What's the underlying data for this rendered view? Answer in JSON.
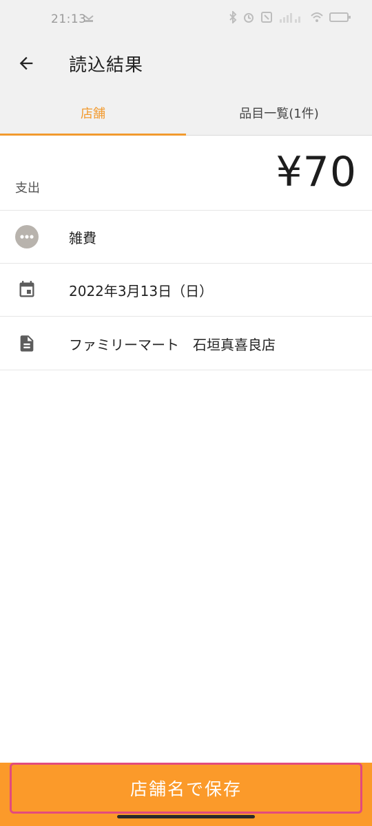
{
  "status_bar": {
    "time": "21:13"
  },
  "app_bar": {
    "title": "読込結果"
  },
  "tabs": [
    {
      "label": "店舗",
      "active": true
    },
    {
      "label": "品目一覧(1件)",
      "active": false
    }
  ],
  "amount": {
    "label": "支出",
    "value": "¥70"
  },
  "details": {
    "category": {
      "icon": "more-horiz-icon",
      "text": "雑費"
    },
    "date": {
      "icon": "calendar-icon",
      "text": "2022年3月13日（日）"
    },
    "store": {
      "icon": "document-icon",
      "text": "ファミリーマート　石垣真喜良店"
    }
  },
  "save_button": {
    "label": "店舗名で保存"
  },
  "colors": {
    "accent": "#f29a2e",
    "button": "#fb9a2a",
    "highlight_border": "#e24b7d"
  }
}
